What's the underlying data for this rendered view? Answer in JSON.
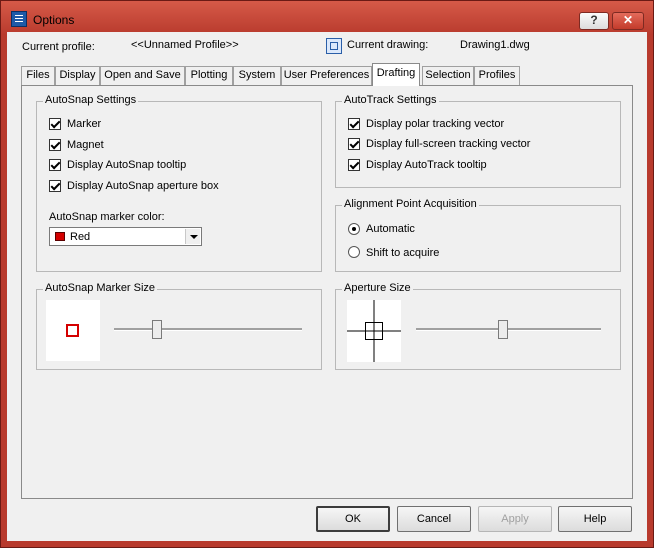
{
  "window": {
    "title": "Options",
    "help_glyph": "?",
    "close_glyph": "✕"
  },
  "header": {
    "profile_label": "Current profile:",
    "profile_value": "<<Unnamed Profile>>",
    "drawing_label": "Current drawing:",
    "drawing_value": "Drawing1.dwg"
  },
  "tabs": [
    {
      "label": "Files"
    },
    {
      "label": "Display"
    },
    {
      "label": "Open and Save"
    },
    {
      "label": "Plotting"
    },
    {
      "label": "System"
    },
    {
      "label": "User Preferences"
    },
    {
      "label": "Drafting",
      "active": true
    },
    {
      "label": "Selection"
    },
    {
      "label": "Profiles"
    }
  ],
  "autosnap": {
    "title": "AutoSnap Settings",
    "options": [
      {
        "label": "Marker",
        "checked": true
      },
      {
        "label": "Magnet",
        "checked": true
      },
      {
        "label": "Display AutoSnap tooltip",
        "checked": true
      },
      {
        "label": "Display AutoSnap aperture box",
        "checked": true
      }
    ],
    "color_label": "AutoSnap marker color:",
    "color_value": "Red",
    "color_hex": "#d40000"
  },
  "autotrack": {
    "title": "AutoTrack Settings",
    "options": [
      {
        "label": "Display polar tracking vector",
        "checked": true
      },
      {
        "label": "Display full-screen tracking vector",
        "checked": true
      },
      {
        "label": "Display AutoTrack tooltip",
        "checked": true
      }
    ]
  },
  "alignment": {
    "title": "Alignment Point Acquisition",
    "options": [
      {
        "label": "Automatic",
        "selected": true
      },
      {
        "label": "Shift to acquire",
        "selected": false
      }
    ]
  },
  "marker_size": {
    "title": "AutoSnap Marker Size",
    "slider_level": 0.23
  },
  "aperture_size": {
    "title": "Aperture Size",
    "slider_level": 0.47
  },
  "buttons": {
    "ok": "OK",
    "cancel": "Cancel",
    "apply": "Apply",
    "help": "Help"
  }
}
